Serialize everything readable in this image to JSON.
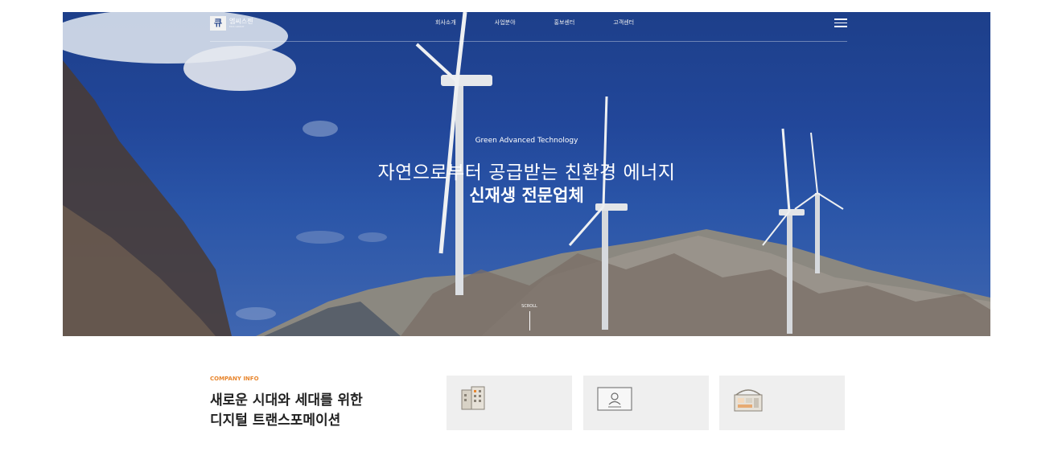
{
  "header": {
    "logo_mark": "큐",
    "logo_text": "엠씨스젠",
    "logo_sub": "MCS GROUP",
    "menu": [
      "회사소개",
      "사업분야",
      "홍보센터",
      "고객센터"
    ]
  },
  "hero": {
    "eyebrow": "Green Advanced Technology",
    "line1": "자연으로부터 공급받는 친환경 에너지",
    "line2": "신재생 전문업체",
    "scroll_label": "SCROLL"
  },
  "company_info": {
    "label": "COMPANY INFO",
    "title_line1": "새로운 시대와 세대를 위한",
    "title_line2": "디지털 트랜스포메이션"
  },
  "cards": [
    {
      "icon": "building-icon"
    },
    {
      "icon": "certificate-icon"
    },
    {
      "icon": "facility-icon"
    }
  ],
  "colors": {
    "accent": "#e8862e",
    "card_bg": "#efefef",
    "sky": "#22479a"
  }
}
